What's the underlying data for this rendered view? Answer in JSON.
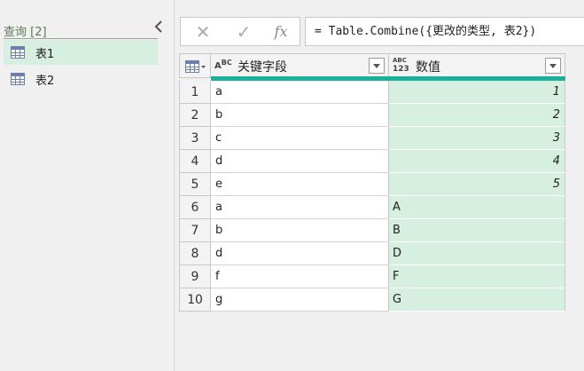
{
  "queries": {
    "title": "查询 [2]",
    "collapse_icon": "chevron-left-icon",
    "items": [
      {
        "label": "表1",
        "icon": "table-icon",
        "selected": true
      },
      {
        "label": "表2",
        "icon": "table-icon",
        "selected": false
      }
    ]
  },
  "formula_bar": {
    "cancel_icon": "✕",
    "confirm_icon": "✓",
    "fx_label": "fx",
    "formula": "= Table.Combine({更改的类型, 表2})"
  },
  "grid": {
    "columns": [
      {
        "name": "关键字段",
        "type_icon_top": "A",
        "type_icon_bottom": "BC",
        "type": "text"
      },
      {
        "name": "数值",
        "type_icon_top": "ABC",
        "type_icon_bottom": "123",
        "type": "any"
      }
    ],
    "rows": [
      {
        "n": "1",
        "key": "a",
        "value": "1",
        "numeric": true
      },
      {
        "n": "2",
        "key": "b",
        "value": "2",
        "numeric": true
      },
      {
        "n": "3",
        "key": "c",
        "value": "3",
        "numeric": true
      },
      {
        "n": "4",
        "key": "d",
        "value": "4",
        "numeric": true
      },
      {
        "n": "5",
        "key": "e",
        "value": "5",
        "numeric": true
      },
      {
        "n": "6",
        "key": "a",
        "value": "A",
        "numeric": false
      },
      {
        "n": "7",
        "key": "b",
        "value": "B",
        "numeric": false
      },
      {
        "n": "8",
        "key": "d",
        "value": "D",
        "numeric": false
      },
      {
        "n": "9",
        "key": "f",
        "value": "F",
        "numeric": false
      },
      {
        "n": "10",
        "key": "g",
        "value": "G",
        "numeric": false
      }
    ]
  },
  "colors": {
    "selected_query_bg": "#d7efe0",
    "quality_bar": "#1ab09a",
    "value_column_bg": "#d7efe0"
  }
}
